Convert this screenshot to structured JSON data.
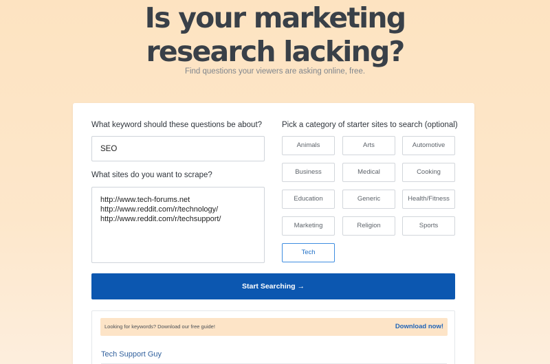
{
  "hero": {
    "title_line1": "Is your marketing",
    "title_line2": "research lacking?",
    "subtitle": "Find questions your viewers are asking online, free."
  },
  "form": {
    "keyword_label": "What keyword should these questions be about?",
    "keyword_value": "SEO",
    "sites_label": "What sites do you want to scrape?",
    "sites": [
      "http://www.tech-forums.net",
      "http://www.reddit.com/r/technology/",
      "http://www.reddit.com/r/techsupport/"
    ],
    "category_label": "Pick a category of starter sites to search (optional)",
    "categories": [
      "Animals",
      "Arts",
      "Automotive",
      "Business",
      "Medical",
      "Cooking",
      "Education",
      "Generic",
      "Health/Fitness",
      "Marketing",
      "Religion",
      "Sports",
      "Tech"
    ],
    "selected_category": "Tech",
    "start_button": "Start Searching →"
  },
  "results": {
    "banner_text": "Looking for keywords? Download our free guide!",
    "banner_link": "Download now!",
    "first_result": "Tech Support Guy"
  },
  "colors": {
    "background": "#fde3c1",
    "primary_button": "#0c57b0",
    "active_category": "#3d8ce0",
    "banner": "#fde4c7",
    "link": "#1f64b8"
  }
}
